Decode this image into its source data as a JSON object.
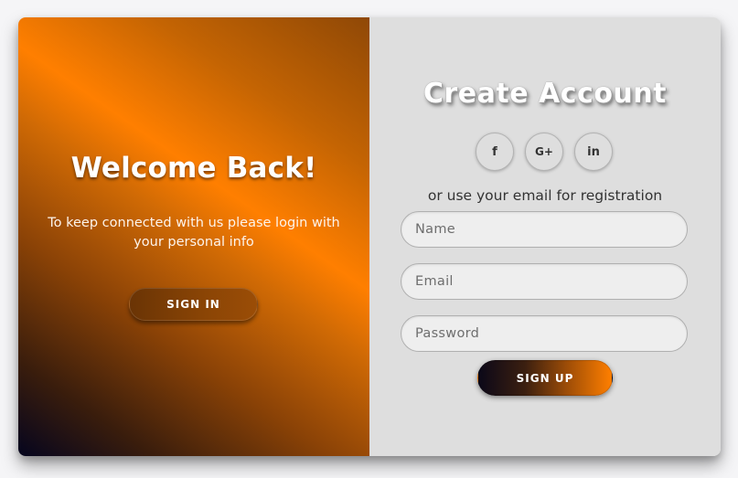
{
  "overlay": {
    "title": "Welcome Back!",
    "message": "To keep connected with us please login with your personal info",
    "signin_label": "SIGN IN"
  },
  "form": {
    "title": "Create Account",
    "social": [
      {
        "icon": "facebook-icon",
        "glyph": "f"
      },
      {
        "icon": "google-plus-icon",
        "glyph": "G+"
      },
      {
        "icon": "linkedin-icon",
        "glyph": "in"
      }
    ],
    "alt_text": "or use your email for registration",
    "fields": {
      "name": {
        "placeholder": "Name",
        "value": ""
      },
      "email": {
        "placeholder": "Email",
        "value": ""
      },
      "password": {
        "placeholder": "Password",
        "value": ""
      }
    },
    "signup_label": "SIGN UP"
  },
  "colors": {
    "accent": "#ff7f00",
    "dark": "#05051e",
    "form_bg": "#dedede"
  }
}
